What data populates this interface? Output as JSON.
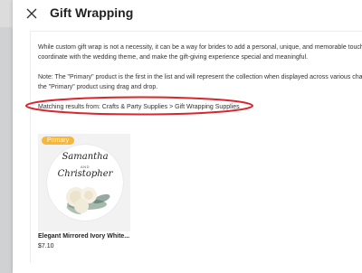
{
  "panel": {
    "title": "Gift Wrapping"
  },
  "description": {
    "line1": "While custom gift wrap is not a necessity, it can be a way for brides to add a personal, unique, and memorable touch",
    "line2": "coordinate with the wedding theme, and make the gift-giving experience special and meaningful."
  },
  "note": {
    "line1": "Note: The \"Primary\" product is the first in the list and will represent the collection when displayed across various cha",
    "line2": "the \"Primary\" product using drag and drop."
  },
  "matching": {
    "text": "Matching results from: Crafts & Party Supplies > Gift Wrapping Supplies"
  },
  "product": {
    "badge": "Primary",
    "name": "Elegant Mirrored Ivory White...",
    "price": "$7.10",
    "image_text": {
      "name1": "Samantha",
      "and": "AND",
      "name2": "Christopher"
    }
  },
  "colors": {
    "badge": "#f5b63a",
    "annotation": "#d9262c"
  },
  "icons": {
    "close": "close-icon"
  }
}
